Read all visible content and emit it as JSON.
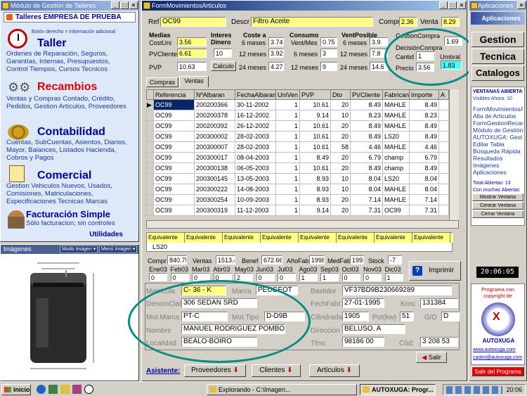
{
  "left_window": {
    "title": "Módulo de Gestión de Talleres",
    "header": "Talleres EMPRESA DE PRUEBA",
    "hint": "Botón derecho = información adicional",
    "sections": [
      {
        "title": "Taller",
        "text": "Ordenes de Reparación, Seguros, Garantías, Internas, Presupuestos, Control Tiempos, Cursos Tecnicos"
      },
      {
        "title": "Recambios",
        "text": "Ventas y Compras Contado, Crédito, Pedidos,  Gestion Artículos, Proveedores"
      },
      {
        "title": "Contabilidad",
        "text": "Cuentas, SubCuentas, Asientos, Diarios, Mayor, Balances, Listados Hacienda, Cobros y Pagos"
      },
      {
        "title": "Comercial",
        "text": "Gestion Vehiculos Nuevos, Usados, Comisiones, Matriculaciones, Especificaciones Tecnicas Marcas"
      },
      {
        "title": "Facturación Simple",
        "text": "Sólo facturacion; sin controles"
      }
    ],
    "utilities": "Utilidades"
  },
  "images_window": {
    "title": "Imágenes",
    "mode_label": "Modo Imágen ▾",
    "menu_label": "Menú Imágen ▾"
  },
  "main_window": {
    "title": "FormMovimientosArticulos",
    "ref_label": "Ref",
    "ref_value": "OC99",
    "descr_label": "Descr",
    "descr_value": "Filtro Aceite",
    "compra_label": "Compra",
    "compra_value": "2.36",
    "venta_label": "Venta",
    "venta_value": "8.29",
    "medias": {
      "title": "Medias",
      "costuni_label": "CostUni",
      "costuni": "3.56",
      "pvcliente_label": "PVCliente",
      "pvcliente": "6.61",
      "pvp_label": "PVP",
      "pvp": "10.63"
    },
    "interes": {
      "title": "Interes Dinero",
      "value": "10",
      "button": "Calculo"
    },
    "coste": {
      "title": "Coste a",
      "rows": [
        {
          "label": "6 meses",
          "value": "3.74"
        },
        {
          "label": "12 meses",
          "value": "3.92"
        },
        {
          "label": "24 meses",
          "value": "4.27"
        }
      ]
    },
    "consumo": {
      "title": "Consumo",
      "rows": [
        {
          "label": "Vent/Mes",
          "value": "0.75"
        },
        {
          "label": "6 meses",
          "value": "3"
        },
        {
          "label": "12 meses",
          "value": "9"
        }
      ]
    },
    "ventposible": {
      "title": "VentPosible",
      "rows": [
        {
          "label": "6 meses",
          "value": "3.9"
        },
        {
          "label": "12 meses",
          "value": "7.8"
        },
        {
          "label": "24 meses",
          "value": "14.6"
        }
      ]
    },
    "gestion": {
      "gc_label": "GestionCompra",
      "gc_value": "1.69",
      "dc_label": "DecisiónCompra",
      "cantid_label": "Cantid",
      "cantid_value": "1",
      "umbral_label": "Umbral",
      "umbral_value": "1.83",
      "precio_label": "Precio",
      "precio_value": "3.56"
    },
    "tabs": [
      "Compras",
      "Ventas"
    ],
    "grid": {
      "headers": [
        "Referencia",
        "NºAlbaran",
        "FechaAlbaran",
        "UniVen",
        "PVP",
        "Dto",
        "PVCliente",
        "Fabricante",
        "Importe",
        "A"
      ],
      "rows": [
        [
          "OC99",
          "200200366",
          "30-11-2002",
          "1",
          "10.61",
          "20",
          "8.49",
          "MAHLE",
          "8.49"
        ],
        [
          "OC99",
          "200200378",
          "16-12-2002",
          "1",
          "9.14",
          "10",
          "8.23",
          "MAHLE",
          "8.23"
        ],
        [
          "OC99",
          "200200392",
          "26-12-2002",
          "1",
          "10.61",
          "20",
          "8.49",
          "MAHLE",
          "8.49"
        ],
        [
          "OC99",
          "200300002",
          "28-02-2003",
          "1",
          "10.61",
          "20",
          "8.49",
          "LS20",
          "8.49"
        ],
        [
          "OC99",
          "200300007",
          "28-02-2003",
          "1",
          "10.61",
          "58",
          "4.46",
          "MAHLE",
          "4.46"
        ],
        [
          "OC99",
          "200300017",
          "08-04-2003",
          "1",
          "8.49",
          "20",
          "6.79",
          "champ",
          "6.79"
        ],
        [
          "OC99",
          "200300138",
          "06-05-2003",
          "1",
          "10.61",
          "20",
          "8.49",
          "champ",
          "8.49"
        ],
        [
          "OC99",
          "200300145",
          "13-05-2003",
          "1",
          "8.93",
          "10",
          "8.04",
          "LS20",
          "8.04"
        ],
        [
          "OC99",
          "200300222",
          "14-08-2003",
          "1",
          "8.93",
          "10",
          "8.04",
          "MAHLE",
          "8.04"
        ],
        [
          "OC99",
          "200300254",
          "10-09-2003",
          "1",
          "8.93",
          "20",
          "7.14",
          "MAHLE",
          "7.14"
        ],
        [
          "OC99",
          "200300319",
          "11-12-2003",
          "1",
          "9.14",
          "20",
          "7.31",
          "OC99",
          "7.31"
        ]
      ]
    },
    "equiv": {
      "header": "Equivalente",
      "first": "LS20"
    },
    "stats": {
      "compr_label": "Compr",
      "compr": "840.75",
      "ventas_label": "Ventas",
      "ventas": "1513.4",
      "benef_label": "Benef",
      "benef": "672.66",
      "anofab_label": "AñoFab",
      "anofab": "1998",
      "medfab_label": "MedFab",
      "medfab": "1992",
      "stock_label": "Stock",
      "stock": "-7"
    },
    "months": [
      "Ene03",
      "Feb03",
      "Mar03",
      "Abr03",
      "May03",
      "Jun03",
      "Jul03",
      "Ago03",
      "Sep03",
      "Oct03",
      "Nov03",
      "Dic03"
    ],
    "month_values": [
      "0",
      "0",
      "0",
      "0",
      "2",
      "0",
      "0",
      "1",
      "1",
      "0",
      "0",
      "1"
    ],
    "print_button": "Imprimir",
    "vehicle": {
      "matricula_label": "Matrícula",
      "matricula": "C- 36 - K",
      "marca_label": "Marca",
      "marca": "PEUGEOT",
      "bastidor_label": "Bastidor",
      "bastidor": "VF37BD9B230669289",
      "denom_label": "DenomCial",
      "denom": "306 SEDAN SRD",
      "fechfabr_label": "FechFabr",
      "fechfabr": "27-01-1995",
      "kms_label": "Kms:",
      "kms": "131384",
      "motmarca_label": "Mot.Marca",
      "motmarca": "PT-C",
      "mottipo_label": "Mot.Tipo",
      "mottipo": "D-D9B",
      "cilindrada_label": "Cilindrada",
      "cilindrada": "1905",
      "pot_label": "Pot(kw)",
      "pot": "51",
      "gd_label": "G/D",
      "gd": "D",
      "nombre_label": "Nombre",
      "nombre": "MANUEL RODRIGUEZ POMBO",
      "direccion_label": "Dirección",
      "direccion": "BELUSO,    A",
      "localidad_label": "Localidad",
      "localidad": "BEALO-BOIRO",
      "tfno_label": "Tfno:",
      "tfno": "98186    00",
      "cod_label": "Cód:",
      "cod": "3  208  53"
    },
    "salir": "Salir",
    "asistente": "Asistente:",
    "asst_buttons": [
      "Proveedores",
      "Clientes",
      "Artículos"
    ]
  },
  "right_window": {
    "title": "Aplicaciones",
    "header": "Aplicaciones",
    "buttons": [
      "Gestion",
      "Tecnica",
      "Catalogos"
    ],
    "open_title": "VENTANAS ABIERTAS",
    "visibles": "Visibles Ahora: 10",
    "links": [
      "FormMovimientosAr",
      "Alta de Artículos",
      "FormGestionRecan",
      "Módulo de Gestión",
      "AUTOXUGA: Gest",
      "Editar Tabla",
      "Búsqueda Rápida",
      "Resultados",
      "Imágenes",
      "Aplicaciones"
    ],
    "total": "Total Abiertas: 13",
    "con_muchas": "Con muchas Abiertas Habrá Problemas",
    "win_buttons": [
      "Mostrar Ventana",
      "Centrar Ventana",
      "Cerrar Ventana"
    ],
    "clock": "20:06:05",
    "promo": "Programa con copyright de",
    "brand": "AUTOXUGA",
    "site": "www.autoxuga.com",
    "email": "castro@autoxuga.com",
    "exit": "Salir del Programa"
  },
  "taskbar": {
    "start": "Inicio",
    "tasks": [
      "Explorando - C:\\Imagen...",
      "AUTOXUGA: Progr..."
    ],
    "time": "20:06"
  },
  "colors": {
    "titlebar": "#0a246a",
    "accent": "#008e85",
    "field_yellow": "#ffff80",
    "blue_text": "#1a3aa0"
  }
}
